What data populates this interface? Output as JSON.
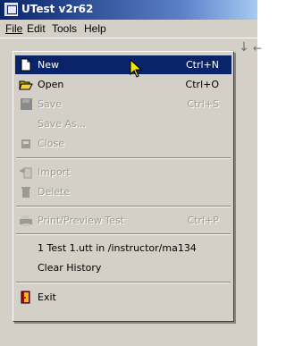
{
  "window": {
    "title": "UTest v2r62"
  },
  "menubar": {
    "items": [
      "File",
      "Edit",
      "Tools",
      "Help"
    ]
  },
  "file_menu": {
    "items": [
      {
        "label": "New",
        "shortcut": "Ctrl+N",
        "icon": "new-document-icon",
        "state": "highlighted"
      },
      {
        "label": "Open",
        "shortcut": "Ctrl+O",
        "icon": "open-folder-icon",
        "state": "enabled"
      },
      {
        "label": "Save",
        "shortcut": "Ctrl+S",
        "icon": "save-icon",
        "state": "disabled"
      },
      {
        "label": "Save As...",
        "shortcut": "",
        "icon": "",
        "state": "disabled"
      },
      {
        "label": "Close",
        "shortcut": "",
        "icon": "close-icon",
        "state": "disabled"
      },
      {
        "label": "Import",
        "shortcut": "",
        "icon": "import-icon",
        "state": "disabled"
      },
      {
        "label": "Delete",
        "shortcut": "",
        "icon": "delete-icon",
        "state": "disabled"
      },
      {
        "label": "Print/Preview Test",
        "shortcut": "Ctrl+P",
        "icon": "printer-icon",
        "state": "disabled"
      },
      {
        "label": "1 Test 1.utt in /instructor/ma134",
        "shortcut": "",
        "icon": "",
        "state": "enabled"
      },
      {
        "label": "Clear History",
        "shortcut": "",
        "icon": "",
        "state": "enabled"
      },
      {
        "label": "Exit",
        "shortcut": "",
        "icon": "exit-door-icon",
        "state": "enabled"
      }
    ]
  },
  "colors": {
    "highlight": "#0a246a",
    "menu_bg": "#d4d0c8",
    "disabled_text": "#9c9a94"
  }
}
